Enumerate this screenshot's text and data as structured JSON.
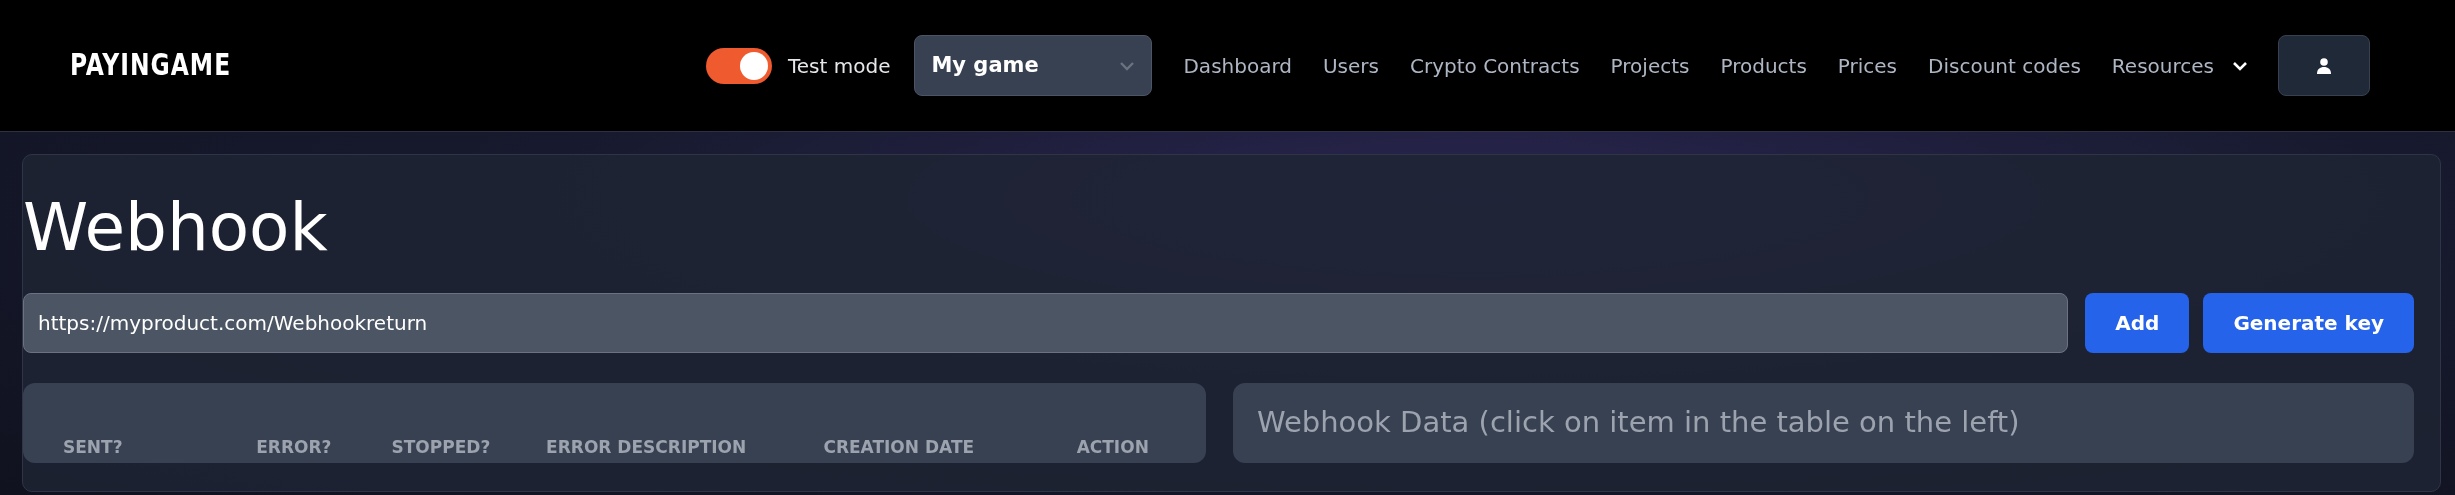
{
  "navbar": {
    "logo": "PAYINGAME",
    "test_mode": {
      "label": "Test mode",
      "on": true
    },
    "project_select": {
      "value": "My game"
    },
    "links": [
      {
        "label": "Dashboard",
        "kind": "link"
      },
      {
        "label": "Users",
        "kind": "link"
      },
      {
        "label": "Crypto Contracts",
        "kind": "link"
      },
      {
        "label": "Projects",
        "kind": "link"
      },
      {
        "label": "Products",
        "kind": "link"
      },
      {
        "label": "Prices",
        "kind": "link"
      },
      {
        "label": "Discount codes",
        "kind": "link"
      },
      {
        "label": "Resources",
        "kind": "dropdown"
      }
    ]
  },
  "page": {
    "title": "Webhook",
    "url_field": {
      "value": "https://myproduct.com/Webhookreturn"
    },
    "buttons": [
      "Add",
      "Generate key"
    ]
  },
  "table": {
    "columns": [
      "SENT?",
      "ERROR?",
      "STOPPED?",
      "ERROR DESCRIPTION",
      "CREATION DATE",
      "ACTION"
    ]
  },
  "details": {
    "title": "Webhook Data (click on item in the table on the left)"
  }
}
